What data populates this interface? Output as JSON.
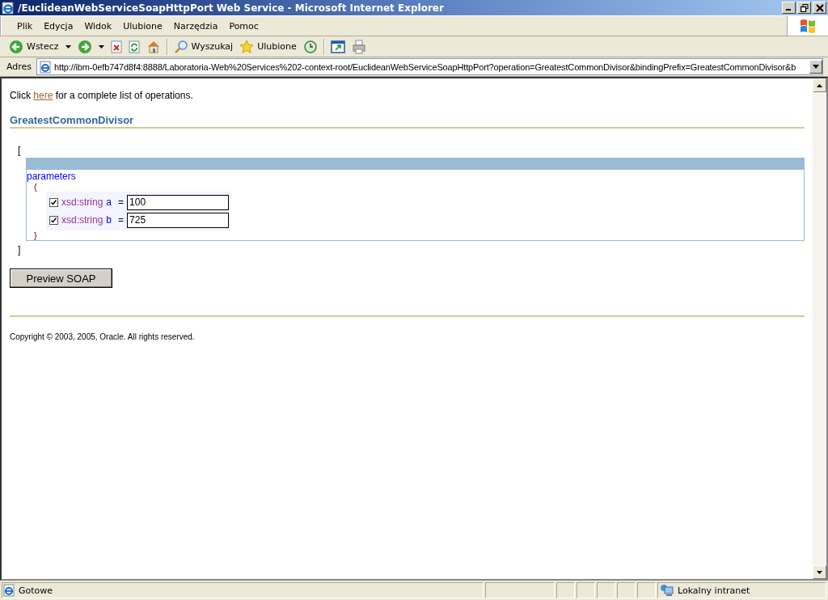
{
  "window": {
    "title": "/EuclideanWebServiceSoapHttpPort Web Service - Microsoft Internet Explorer"
  },
  "menu": [
    {
      "label": "Plik"
    },
    {
      "label": "Edycja"
    },
    {
      "label": "Widok"
    },
    {
      "label": "Ulubione"
    },
    {
      "label": "Narzędzia"
    },
    {
      "label": "Pomoc"
    }
  ],
  "toolbar": [
    {
      "kind": "back",
      "label": "Wstecz",
      "dropdown": true
    },
    {
      "kind": "forward",
      "dropdown": true
    },
    {
      "kind": "stop",
      "dropdown": false
    },
    {
      "kind": "refresh",
      "dropdown": false
    },
    {
      "kind": "home",
      "dropdown": false
    },
    {
      "kind": "search",
      "label": "Wyszukaj",
      "dropdown": false
    },
    {
      "kind": "star",
      "label": "Ulubione",
      "dropdown": false
    },
    {
      "kind": "history",
      "dropdown": false
    },
    {
      "kind": "window",
      "dropdown": false
    },
    {
      "kind": "printer",
      "dropdown": false
    }
  ],
  "address": {
    "label": "Adres",
    "url": "http://ibm-0efb747d8f4:8888/Laboratoria-Web%20Services%202-context-root/EuclideanWebServiceSoapHttpPort?operation=GreatestCommonDivisor&bindingPrefix=GreatestCommonDivisor&b"
  },
  "page": {
    "intro": {
      "before": "Click ",
      "link": "here",
      "after": " for a complete list of operations."
    },
    "heading": "GreatestCommonDivisor",
    "open_bracket": "[",
    "params_label": "parameters",
    "open_brace": "{",
    "fields": [
      {
        "checked": true,
        "type": "xsd:string",
        "name": "a",
        "equals": "=",
        "value": "100"
      },
      {
        "checked": true,
        "type": "xsd:string",
        "name": "b",
        "equals": "=",
        "value": "725"
      }
    ],
    "close_brace": "}",
    "close_bracket": "]",
    "button": "Preview SOAP",
    "copyright": "Copyright © 2003, 2005, Oracle. All rights reserved."
  },
  "status_bar": {
    "text": "Gotowe",
    "zone": "Lokalny intranet"
  }
}
